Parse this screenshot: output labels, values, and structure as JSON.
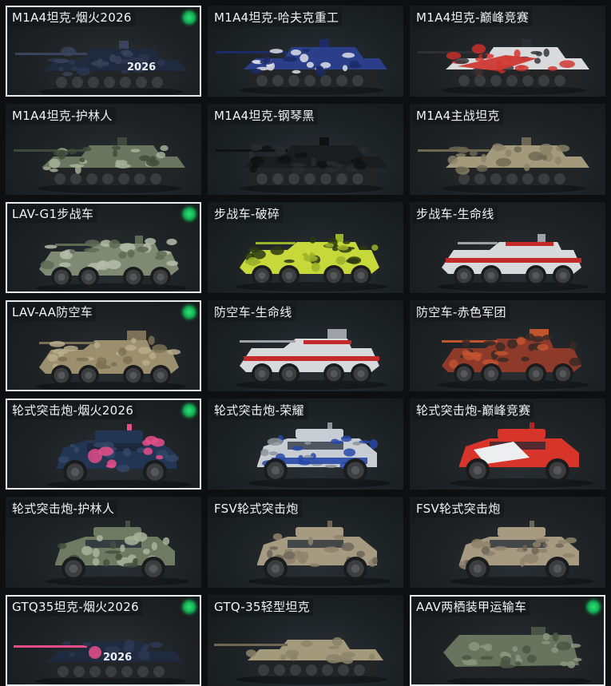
{
  "cards": [
    {
      "label": "M1A4坦克-烟火2026",
      "selected": true,
      "owned": true,
      "type": "tank",
      "skin": "fireworks",
      "colors": [
        "#1f2a3f",
        "#2c3852",
        "#3a445c"
      ],
      "decal": "2026"
    },
    {
      "label": "M1A4坦克-哈夫克重工",
      "selected": false,
      "owned": false,
      "type": "tank",
      "skin": "haavk",
      "colors": [
        "#2a3e8a",
        "#e6e8ee",
        "#1c2a66"
      ],
      "decal": ""
    },
    {
      "label": "M1A4坦克-巅峰竞赛",
      "selected": false,
      "owned": false,
      "type": "tank",
      "skin": "racing",
      "colors": [
        "#d8dadc",
        "#d1302a",
        "#2c2f33"
      ],
      "decal": ""
    },
    {
      "label": "M1A4坦克-护林人",
      "selected": false,
      "owned": false,
      "type": "tank",
      "skin": "forest",
      "colors": [
        "#6b7660",
        "#aab59a",
        "#3f4a3a"
      ],
      "decal": ""
    },
    {
      "label": "M1A4坦克-钢琴黑",
      "selected": false,
      "owned": false,
      "type": "tank",
      "skin": "black",
      "colors": [
        "#1a1c1e",
        "#2a2d30",
        "#0f1112"
      ],
      "decal": ""
    },
    {
      "label": "M1A4主战坦克",
      "selected": false,
      "owned": false,
      "type": "tank",
      "skin": "desert",
      "colors": [
        "#a39a7c",
        "#8c846a",
        "#6e6852"
      ],
      "decal": ""
    },
    {
      "label": "LAV-G1步战车",
      "selected": true,
      "owned": true,
      "type": "ifv",
      "skin": "camo",
      "colors": [
        "#7f8a72",
        "#b5bcaa",
        "#5f6a55"
      ],
      "decal": ""
    },
    {
      "label": "步战车-破碎",
      "selected": false,
      "owned": false,
      "type": "ifv",
      "skin": "shatter",
      "colors": [
        "#c6d83a",
        "#2b3a14",
        "#9cb22a"
      ],
      "decal": ""
    },
    {
      "label": "步战车-生命线",
      "selected": false,
      "owned": false,
      "type": "ifv",
      "skin": "lifeline",
      "colors": [
        "#d8d9db",
        "#c42a2a",
        "#9ea1a5"
      ],
      "decal": ""
    },
    {
      "label": "LAV-AA防空车",
      "selected": true,
      "owned": true,
      "type": "aa",
      "skin": "sand",
      "colors": [
        "#9c8f6e",
        "#b9ad8b",
        "#7c7156"
      ],
      "decal": ""
    },
    {
      "label": "防空车-生命线",
      "selected": false,
      "owned": false,
      "type": "aa",
      "skin": "lifeline",
      "colors": [
        "#d8d9db",
        "#c42a2a",
        "#9ea1a5"
      ],
      "decal": ""
    },
    {
      "label": "防空车-赤色军团",
      "selected": false,
      "owned": false,
      "type": "aa",
      "skin": "redlegion",
      "colors": [
        "#8e3a2a",
        "#3b2a26",
        "#c2542e"
      ],
      "decal": ""
    },
    {
      "label": "轮式突击炮-烟火2026",
      "selected": true,
      "owned": true,
      "type": "wheeled",
      "skin": "fireworks",
      "colors": [
        "#223552",
        "#32476a",
        "#e84d8a"
      ],
      "decal": ""
    },
    {
      "label": "轮式突击炮-荣耀",
      "selected": false,
      "owned": false,
      "type": "wheeled",
      "skin": "glory",
      "colors": [
        "#c8cdd3",
        "#2848a8",
        "#8d939a"
      ],
      "decal": ""
    },
    {
      "label": "轮式突击炮-巅峰竞赛",
      "selected": false,
      "owned": false,
      "type": "wheeled",
      "skin": "racing",
      "colors": [
        "#d8352a",
        "#eceeef",
        "#a92820"
      ],
      "decal": ""
    },
    {
      "label": "轮式突击炮-护林人",
      "selected": false,
      "owned": false,
      "type": "wheeled",
      "skin": "forest",
      "colors": [
        "#6e7a62",
        "#aab49a",
        "#445040"
      ],
      "decal": ""
    },
    {
      "label": "FSV轮式突击炮",
      "selected": false,
      "owned": false,
      "type": "wheeled",
      "skin": "desert",
      "colors": [
        "#a69a80",
        "#8e836c",
        "#6f665a"
      ],
      "decal": ""
    },
    {
      "label": "FSV轮式突击炮",
      "selected": false,
      "owned": false,
      "type": "wheeled",
      "skin": "desert",
      "colors": [
        "#a69a80",
        "#8e836c",
        "#6f665a"
      ],
      "decal": ""
    },
    {
      "label": "GTQ35坦克-烟火2026",
      "selected": true,
      "owned": true,
      "type": "light",
      "skin": "fireworks",
      "colors": [
        "#1f2a3f",
        "#2c3852",
        "#e84d8a"
      ],
      "decal": "2026"
    },
    {
      "label": "GTQ-35轻型坦克",
      "selected": false,
      "owned": false,
      "type": "light",
      "skin": "desert",
      "colors": [
        "#a39a7c",
        "#8c846a",
        "#6e6852"
      ],
      "decal": ""
    },
    {
      "label": "AAV两栖装甲运输车",
      "selected": true,
      "owned": true,
      "type": "aav",
      "skin": "forest",
      "colors": [
        "#6a735e",
        "#8c9580",
        "#4b5444"
      ],
      "decal": ""
    }
  ]
}
